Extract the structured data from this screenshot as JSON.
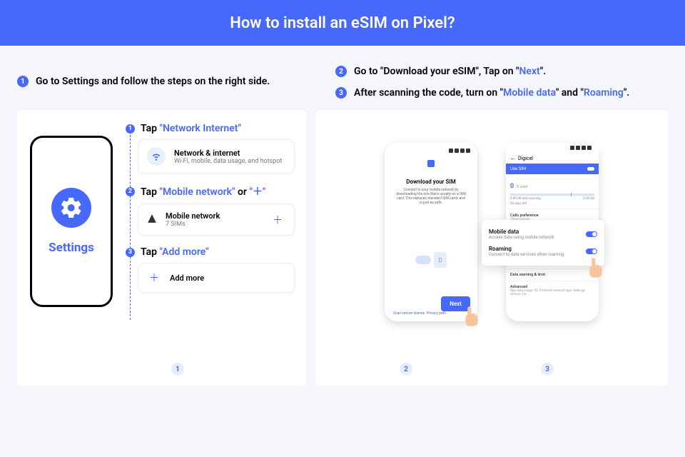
{
  "header": {
    "title": "How to install an eSIM on Pixel?"
  },
  "top": {
    "step1": "Go to Settings and follow the steps on the right side.",
    "step2_pre": "Go to \"Download your eSIM\", Tap on \"",
    "step2_hl": "Next",
    "step2_post": "\".",
    "step3_pre": "After scanning the code, turn on \"",
    "step3_hl1": "Mobile data",
    "step3_mid": "\" and \"",
    "step3_hl2": "Roaming",
    "step3_post": "\"."
  },
  "left_phone": {
    "label": "Settings"
  },
  "substeps": {
    "s1_pre": "Tap ",
    "s1_hl": "\"Network Internet\"",
    "s2_pre": "Tap ",
    "s2_hl1": "\"Mobile network\"",
    "s2_mid": " or ",
    "s2_hl2": "\"＋\"",
    "s3_pre": "Tap ",
    "s3_hl": "\"Add more\""
  },
  "card_network": {
    "title": "Network & internet",
    "sub": "Wi-Fi, mobile, data usage, and hotspot"
  },
  "card_mobile": {
    "title": "Mobile network",
    "sub": "7 SIMs",
    "plus": "＋"
  },
  "card_add": {
    "title": "Add more",
    "plus": "＋"
  },
  "phone2a": {
    "title": "Download your SIM",
    "desc": "Connect to your mobile network by downloading the info that's usually on a SIM card. This replaces standard SIM cards and is just as safe.",
    "footer": "Scan secure license. Privacy path.",
    "next": "Next"
  },
  "phone2b": {
    "carrier": "Digicel",
    "use_sim": "Use SIM",
    "zero": "0",
    "used": "B used",
    "warn": "2.00 GB data warning",
    "days": "30 days left",
    "cap": "2.00 GB",
    "calls": "Calls preference",
    "calls_sub": "China Unicom",
    "md_title": "Mobile data",
    "md_sub": "Access data using mobile network",
    "rm_title": "Roaming",
    "rm_sub": "Connect to data services when roaming",
    "dw": "Data warning & limit",
    "adv": "Advanced",
    "adv_sub": "App data usage, 5G, Preferred network type, Settings version, Ca..."
  },
  "nums": {
    "n1": "1",
    "n2": "2",
    "n3": "3"
  }
}
